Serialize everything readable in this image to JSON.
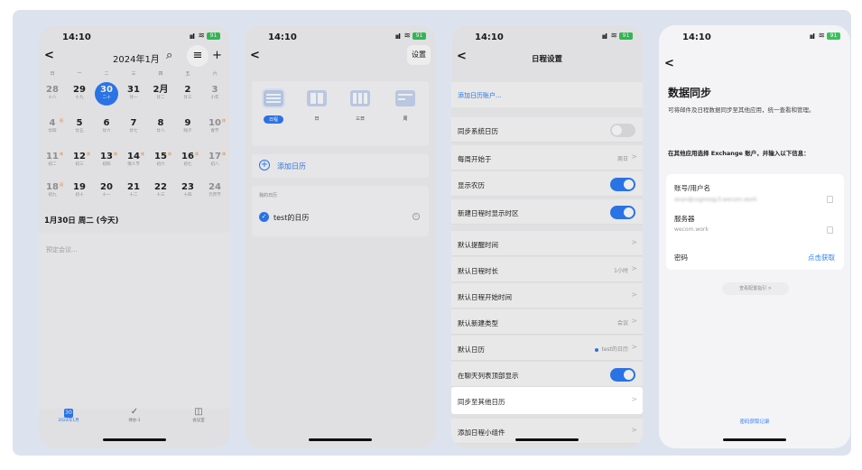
{
  "status": {
    "time": "14:10",
    "battery": "91"
  },
  "screen1": {
    "month_title": "2024年1月",
    "weekdays": [
      "日",
      "一",
      "二",
      "三",
      "四",
      "五",
      "六"
    ],
    "weeks": [
      [
        {
          "d": "28",
          "s": "十八"
        },
        {
          "d": "29",
          "s": "十九"
        },
        {
          "d": "30",
          "s": "二十"
        },
        {
          "d": "31",
          "s": "廿一"
        },
        {
          "d": "2月",
          "s": "廿二"
        },
        {
          "d": "2",
          "s": "廿三"
        },
        {
          "d": "3",
          "s": "小年"
        }
      ],
      [
        {
          "d": "4",
          "s": "廿四",
          "m": "班"
        },
        {
          "d": "5",
          "s": "廿五"
        },
        {
          "d": "6",
          "s": "廿六"
        },
        {
          "d": "7",
          "s": "廿七"
        },
        {
          "d": "8",
          "s": "廿八"
        },
        {
          "d": "9",
          "s": "除夕"
        },
        {
          "d": "10",
          "s": "春节",
          "m": "休"
        }
      ],
      [
        {
          "d": "11",
          "s": "初二",
          "m": "休"
        },
        {
          "d": "12",
          "s": "初三",
          "m": "休"
        },
        {
          "d": "13",
          "s": "初四",
          "m": "休"
        },
        {
          "d": "14",
          "s": "情人节",
          "m": "休"
        },
        {
          "d": "15",
          "s": "初六",
          "m": "休"
        },
        {
          "d": "16",
          "s": "初七",
          "m": "休"
        },
        {
          "d": "17",
          "s": "初八",
          "m": "休"
        }
      ],
      [
        {
          "d": "18",
          "s": "初九",
          "m": "班"
        },
        {
          "d": "19",
          "s": "初十"
        },
        {
          "d": "20",
          "s": "十一"
        },
        {
          "d": "21",
          "s": "十二"
        },
        {
          "d": "22",
          "s": "十三"
        },
        {
          "d": "23",
          "s": "十四"
        },
        {
          "d": "24",
          "s": "元宵节"
        }
      ]
    ],
    "day_title": "1月30日 周二 (今天)",
    "hint": "预定会议...",
    "tabs": [
      {
        "icon": "30",
        "label": "2024年1月"
      },
      {
        "icon": "✓",
        "label": "待办·1"
      },
      {
        "icon": "◫",
        "label": "会议室"
      }
    ]
  },
  "screen2": {
    "settings": "设置",
    "views": [
      "日程",
      "日",
      "三日",
      "周"
    ],
    "add_calendar": "添加日历",
    "section": "我的日历",
    "calendar_name": "test的日历"
  },
  "screen3": {
    "title": "日程设置",
    "add_account": "添加日历账户...",
    "rows": [
      {
        "label": "同步系统日历",
        "type": "toggle",
        "on": false
      },
      {
        "label": "每周开始于",
        "type": "value",
        "value": "周日"
      },
      {
        "label": "显示农历",
        "type": "toggle",
        "on": true
      },
      {
        "label": "新建日程时显示时区",
        "type": "toggle",
        "on": true
      },
      {
        "label": "默认提醒时间",
        "type": "chev"
      },
      {
        "label": "默认日程时长",
        "type": "value",
        "value": "1小时"
      },
      {
        "label": "默认日程开始时间",
        "type": "chev"
      },
      {
        "label": "默认新建类型",
        "type": "value",
        "value": "会议"
      },
      {
        "label": "默认日历",
        "type": "value",
        "value": "test的日历",
        "dot": true
      },
      {
        "label": "在聊天列表顶部显示",
        "type": "toggle",
        "on": true
      }
    ],
    "sync_other": "同步至其他日历",
    "add_widget": "添加日程小组件"
  },
  "screen4": {
    "title": "数据同步",
    "desc": "可将邮件及日程数据同步至其他应用，统一查看和管理。",
    "desc2": "在其他应用选择 Exchange 账户，并输入以下信息：",
    "account_label": "账号/用户名",
    "account_value": "anan@csgmxqy3.wecom.work",
    "server_label": "服务器",
    "server_value": "wecom.work",
    "password_label": "密码",
    "password_action": "点击获取",
    "guide": "查看配置指引 >",
    "record": "密码获取记录"
  }
}
